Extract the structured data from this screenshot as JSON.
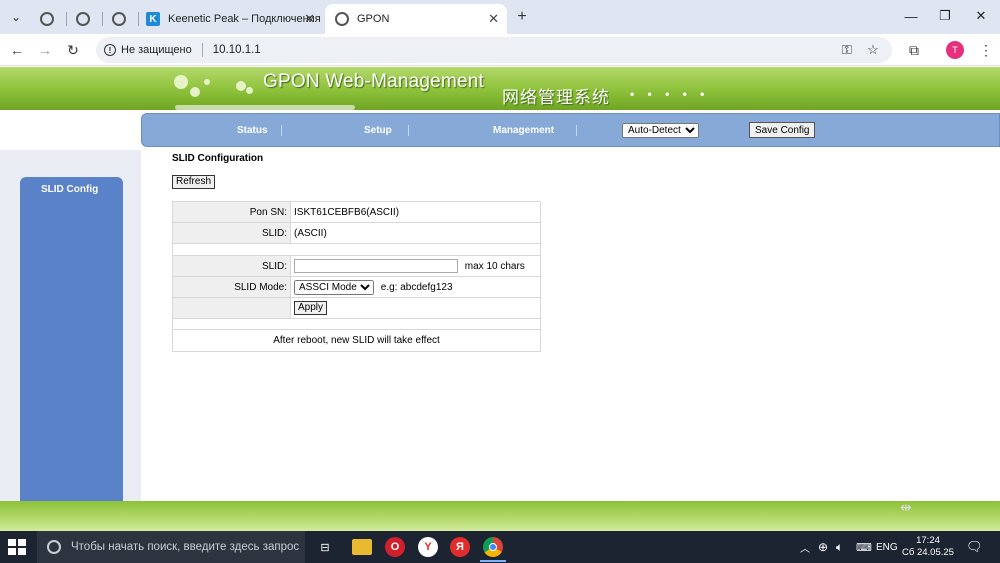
{
  "browser": {
    "tabs": [
      {
        "label": ""
      },
      {
        "label": ""
      },
      {
        "label": ""
      },
      {
        "label": "Keenetic Peak – Подключения"
      },
      {
        "label": "GPON",
        "active": true
      }
    ],
    "security_label": "Не защищено",
    "url": "10.10.1.1",
    "profile_initial": "T"
  },
  "banner": {
    "title_en": "GPON Web-Management",
    "title_cn": "网络管理系统",
    "dots": "• • • • •"
  },
  "nav": {
    "status": "Status",
    "setup": "Setup",
    "management": "Management",
    "language_selected": "Auto-Detect",
    "save_config": "Save Config"
  },
  "sidebar": {
    "items": [
      {
        "label": "SLID Config"
      }
    ]
  },
  "main": {
    "title": "SLID Configuration",
    "refresh_label": "Refresh",
    "pon_sn_label": "Pon SN:",
    "pon_sn_value": "ISKT61CEBFB6(ASCII)",
    "slid_label": "SLID:",
    "slid_value": "(ASCII)",
    "slid_input_label": "SLID:",
    "slid_input_value": "",
    "slid_input_hint": "max 10 chars",
    "slid_mode_label": "SLID Mode:",
    "slid_mode_selected": "ASSCI Mode",
    "slid_mode_hint": "e.g: abcdefg123",
    "apply_label": "Apply",
    "note": "After reboot, new SLID will take effect"
  },
  "taskbar": {
    "search_placeholder": "Чтобы начать поиск, введите здесь запрос",
    "language": "ENG",
    "time": "17:24",
    "date": "Сб 24.05.25"
  },
  "colors": {
    "banner_green": "#8dc13a",
    "nav_blue": "#87a9d8",
    "sidebar_blue": "#5a82c8"
  }
}
